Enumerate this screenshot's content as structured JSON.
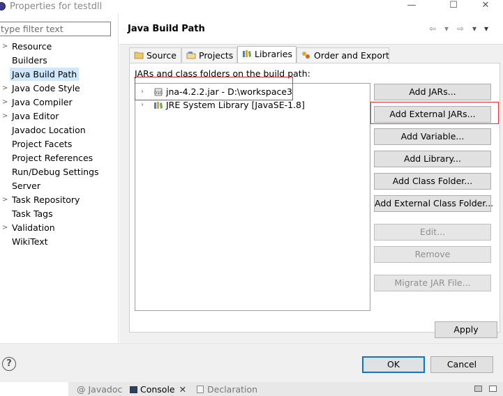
{
  "window": {
    "title": "Properties for testdll",
    "minimize": "—",
    "maximize": "☐",
    "close": "✕"
  },
  "filter": {
    "placeholder": "type filter text"
  },
  "tree": {
    "items": [
      {
        "label": "Resource",
        "expandable": true
      },
      {
        "label": "Builders",
        "expandable": false
      },
      {
        "label": "Java Build Path",
        "expandable": false,
        "selected": true
      },
      {
        "label": "Java Code Style",
        "expandable": true
      },
      {
        "label": "Java Compiler",
        "expandable": true
      },
      {
        "label": "Java Editor",
        "expandable": true
      },
      {
        "label": "Javadoc Location",
        "expandable": false
      },
      {
        "label": "Project Facets",
        "expandable": false
      },
      {
        "label": "Project References",
        "expandable": false
      },
      {
        "label": "Run/Debug Settings",
        "expandable": false
      },
      {
        "label": "Server",
        "expandable": false
      },
      {
        "label": "Task Repository",
        "expandable": true
      },
      {
        "label": "Task Tags",
        "expandable": false
      },
      {
        "label": "Validation",
        "expandable": true
      },
      {
        "label": "WikiText",
        "expandable": false
      }
    ]
  },
  "page": {
    "title": "Java Build Path",
    "nav": {
      "back": "⇦",
      "back_menu": "▾",
      "forward": "⇨",
      "forward_menu": "▾",
      "view_menu": "▾"
    }
  },
  "tabs": [
    {
      "label": "Source"
    },
    {
      "label": "Projects"
    },
    {
      "label": "Libraries",
      "active": true
    },
    {
      "label": "Order and Export"
    }
  ],
  "libraries": {
    "caption": "JARs and class folders on the build path:",
    "entries": [
      {
        "label": "jna-4.2.2.jar - D:\\workspace3"
      },
      {
        "label": "JRE System Library [JavaSE-1.8]"
      }
    ],
    "chevron": "›"
  },
  "buttons": {
    "add_jars": "Add JARs...",
    "add_external_jars": "Add External JARs...",
    "add_variable": "Add Variable...",
    "add_library": "Add Library...",
    "add_class_folder": "Add Class Folder...",
    "add_external_class_folder": "Add External Class Folder...",
    "edit": "Edit...",
    "remove": "Remove",
    "migrate_jar": "Migrate JAR File...",
    "apply": "Apply",
    "ok": "OK",
    "cancel": "Cancel"
  },
  "help": {
    "symbol": "?"
  },
  "bottom_views": [
    {
      "label": "Javadoc"
    },
    {
      "label": "Console",
      "active": true
    },
    {
      "label": "Declaration"
    }
  ],
  "colors": {
    "selection": "#cde8ff",
    "highlight_box": "#e83030",
    "default_button_border": "#0078d7"
  }
}
